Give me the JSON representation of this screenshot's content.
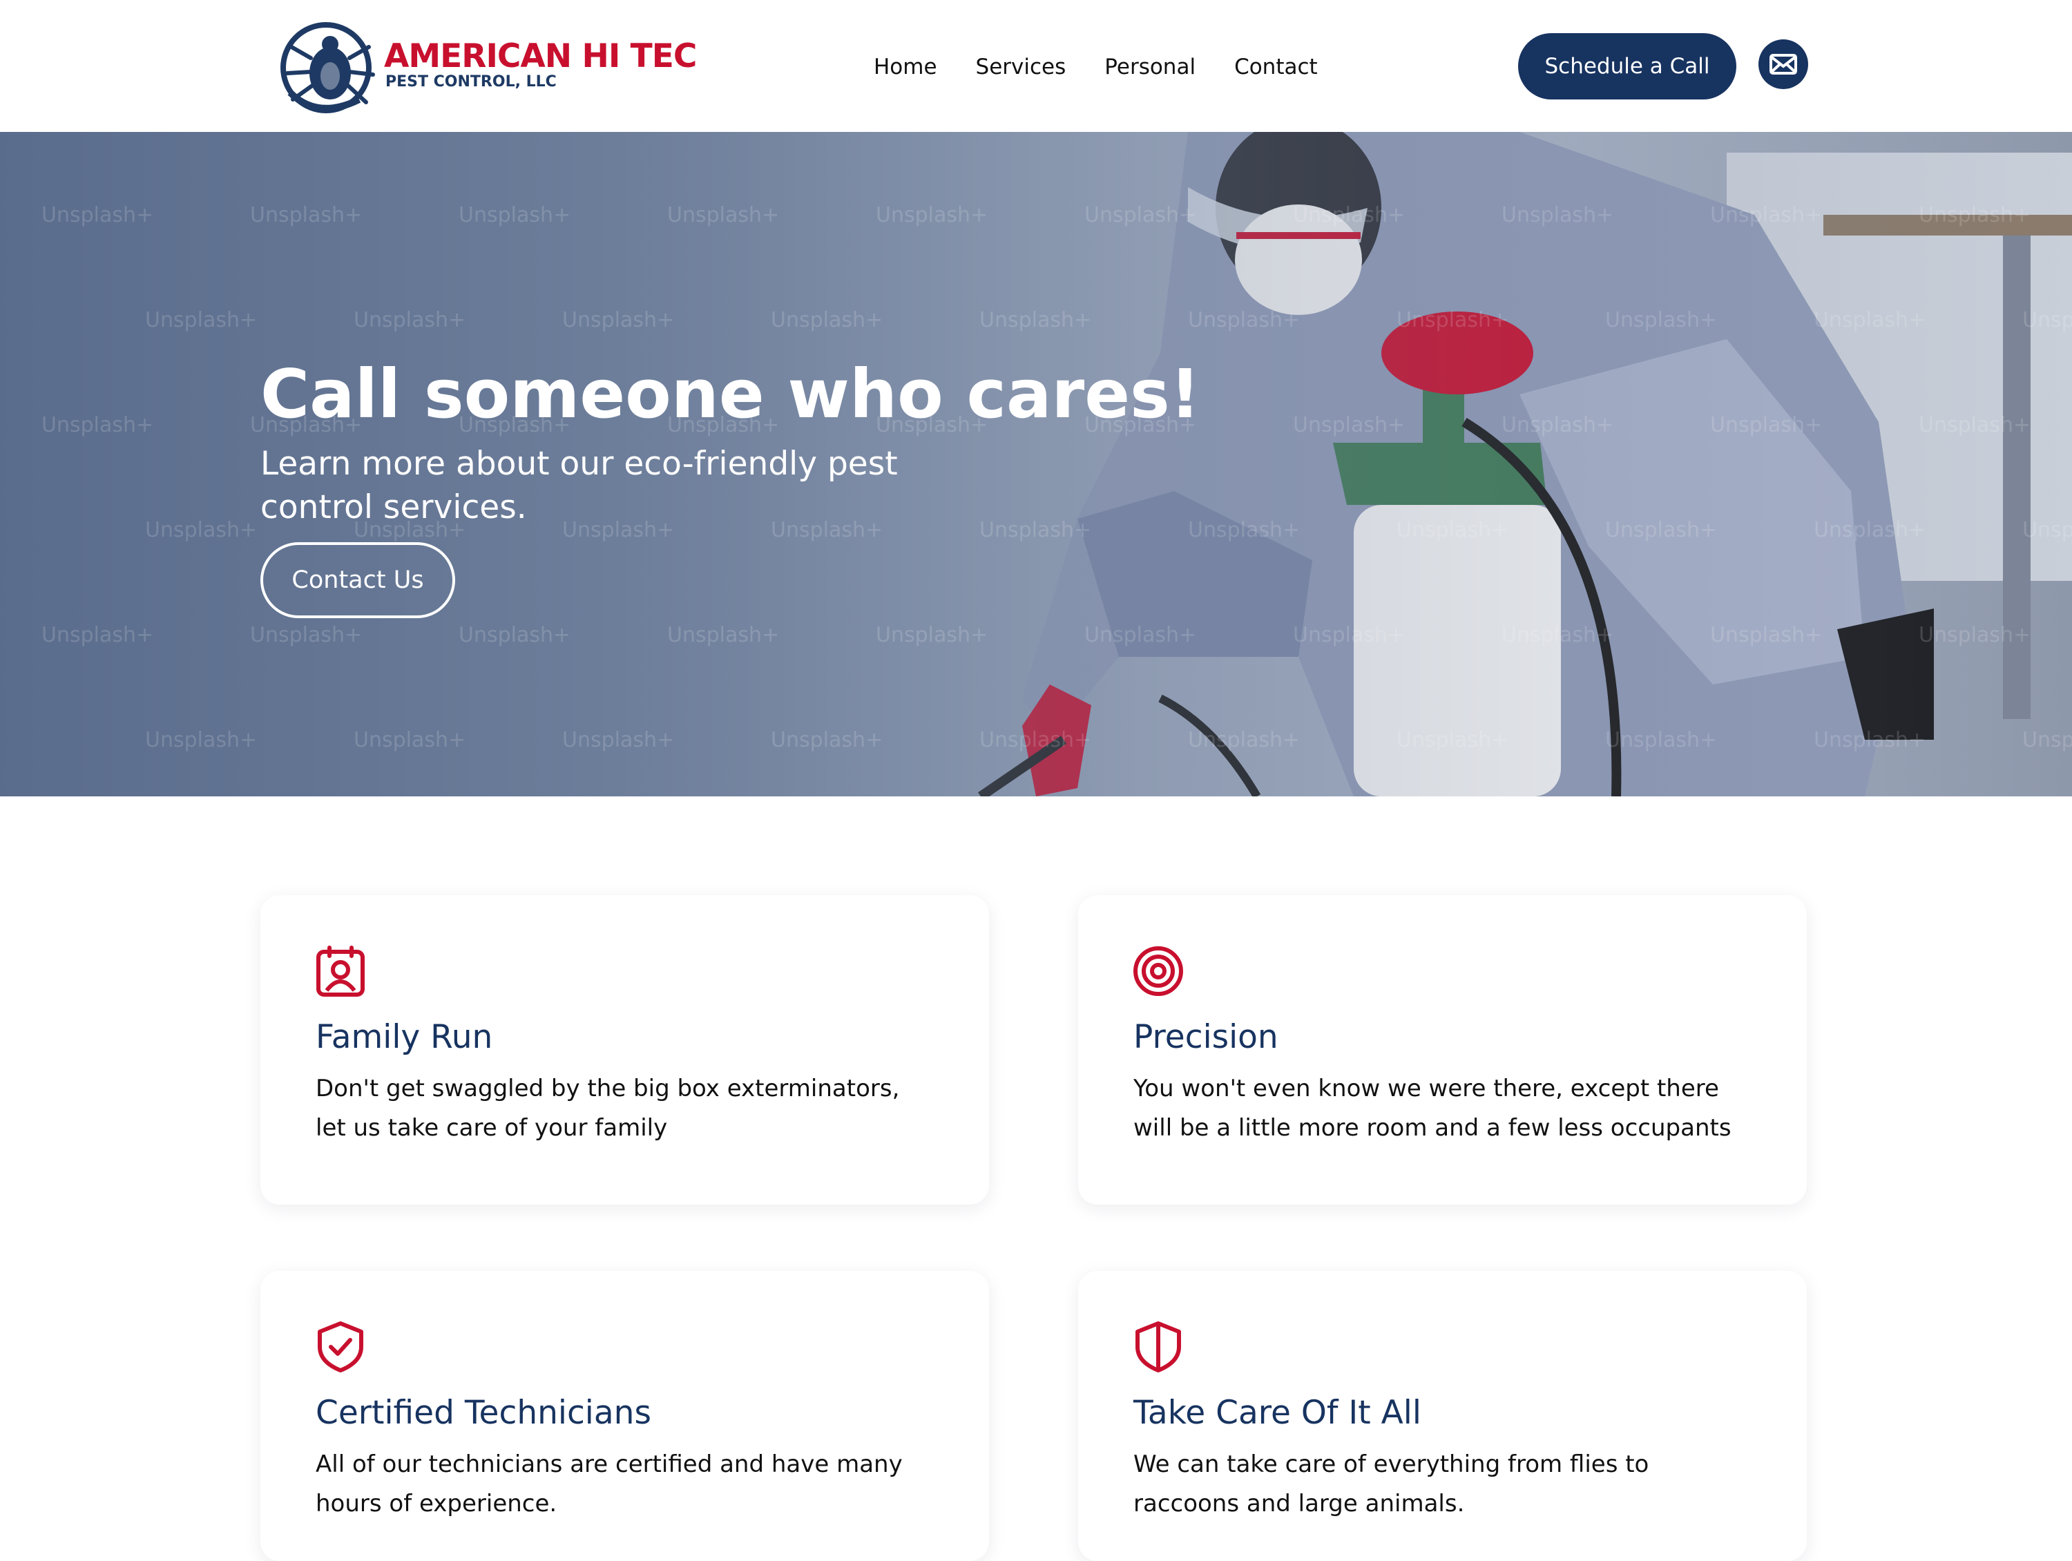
{
  "brand": {
    "title": "AMERICAN HI TEC",
    "subtitle": "PEST CONTROL, LLC",
    "icon": "tick-logo-icon",
    "colors": {
      "red": "#c8102e",
      "navy": "#173360"
    }
  },
  "nav": {
    "items": [
      {
        "label": "Home"
      },
      {
        "label": "Services"
      },
      {
        "label": "Personal"
      },
      {
        "label": "Contact"
      }
    ],
    "cta_label": "Schedule a Call",
    "mail_icon": "mail-icon"
  },
  "hero": {
    "title": "Call someone who cares!",
    "subtitle": "Learn more about our eco-friendly pest control services.",
    "button_label": "Contact Us",
    "watermark": "Unsplash+"
  },
  "features": [
    {
      "icon": "user-badge-icon",
      "title": "Family Run",
      "text": "Don't get swaggled by the big box exterminators, let us take care of your family"
    },
    {
      "icon": "target-icon",
      "title": "Precision",
      "text": "You won't even know we were there, except there will be a little more room and a few less occupants"
    },
    {
      "icon": "shield-check-icon",
      "title": "Certified Technicians",
      "text": "All of our technicians are certified and have many hours of experience."
    },
    {
      "icon": "shield-icon",
      "title": "Take Care Of It All",
      "text": "We can take care of everything from flies to raccoons and large animals."
    }
  ]
}
